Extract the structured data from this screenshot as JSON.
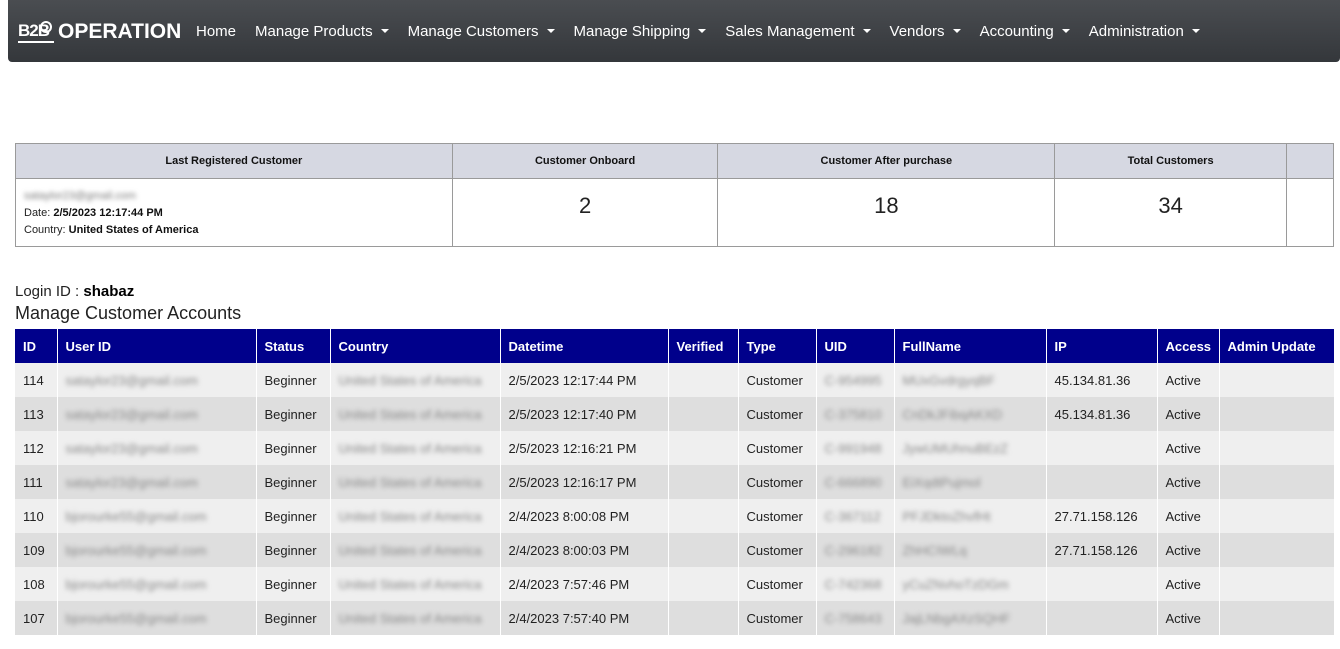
{
  "brand": {
    "logo_text": "B2B",
    "name": "OPERATION"
  },
  "nav": [
    {
      "label": "Home",
      "dropdown": false
    },
    {
      "label": "Manage Products",
      "dropdown": true
    },
    {
      "label": "Manage Customers",
      "dropdown": true
    },
    {
      "label": "Manage Shipping",
      "dropdown": true
    },
    {
      "label": "Sales Management",
      "dropdown": true
    },
    {
      "label": "Vendors",
      "dropdown": true
    },
    {
      "label": "Accounting",
      "dropdown": true
    },
    {
      "label": "Administration",
      "dropdown": true
    }
  ],
  "summary": {
    "headers": [
      "Last Registered Customer",
      "Customer Onboard",
      "Customer After purchase",
      "Total Customers",
      ""
    ],
    "last_email": "sataylor23@gmail.com",
    "date_label": "Date:",
    "date_value": "2/5/2023 12:17:44 PM",
    "country_label": "Country:",
    "country_value": "United States of America",
    "onboard": "2",
    "after_purchase": "18",
    "total": "34"
  },
  "login": {
    "label": "Login ID :",
    "value": "shabaz"
  },
  "heading": "Manage Customer Accounts",
  "table": {
    "columns": [
      "ID",
      "User ID",
      "Status",
      "Country",
      "Datetime",
      "Verified",
      "Type",
      "UID",
      "FullName",
      "IP",
      "Access",
      "Admin Update"
    ],
    "rows": [
      [
        "114",
        "sataylor23@gmail.com",
        "Beginner",
        "United States of America",
        "2/5/2023 12:17:44 PM",
        "",
        "Customer",
        "C-954995",
        "MUxGvdrgyqBF",
        "45.134.81.36",
        "Active",
        ""
      ],
      [
        "113",
        "sataylor23@gmail.com",
        "Beginner",
        "United States of America",
        "2/5/2023 12:17:40 PM",
        "",
        "Customer",
        "C-375810",
        "CnDkJFibqAKXD",
        "45.134.81.36",
        "Active",
        ""
      ],
      [
        "112",
        "sataylor23@gmail.com",
        "Beginner",
        "United States of America",
        "2/5/2023 12:16:21 PM",
        "",
        "Customer",
        "C-991948",
        "JywUMUhnuBEzZ",
        "",
        "Active",
        ""
      ],
      [
        "111",
        "sataylor23@gmail.com",
        "Beginner",
        "United States of America",
        "2/5/2023 12:16:17 PM",
        "",
        "Customer",
        "C-666890",
        "EiXqdtPujmol",
        "",
        "Active",
        ""
      ],
      [
        "110",
        "bjorourke55@gmail.com",
        "Beginner",
        "United States of America",
        "2/4/2023 8:00:08 PM",
        "",
        "Customer",
        "C-367112",
        "PFJDktoZhvfHt",
        "27.71.158.126",
        "Active",
        ""
      ],
      [
        "109",
        "bjorourke55@gmail.com",
        "Beginner",
        "United States of America",
        "2/4/2023 8:00:03 PM",
        "",
        "Customer",
        "C-296182",
        "ZhHCIWLq",
        "27.71.158.126",
        "Active",
        ""
      ],
      [
        "108",
        "bjorourke55@gmail.com",
        "Beginner",
        "United States of America",
        "2/4/2023 7:57:46 PM",
        "",
        "Customer",
        "C-742368",
        "yCuZNvhoTzDGm",
        "",
        "Active",
        ""
      ],
      [
        "107",
        "bjorourke55@gmail.com",
        "Beginner",
        "United States of America",
        "2/4/2023 7:57:40 PM",
        "",
        "Customer",
        "C-758643",
        "JajLNbgAXzSQHF",
        "",
        "Active",
        ""
      ]
    ]
  },
  "colors": {
    "navbar": "#3d4044",
    "table_header": "#00008b",
    "summary_header": "#d6d8e2"
  }
}
